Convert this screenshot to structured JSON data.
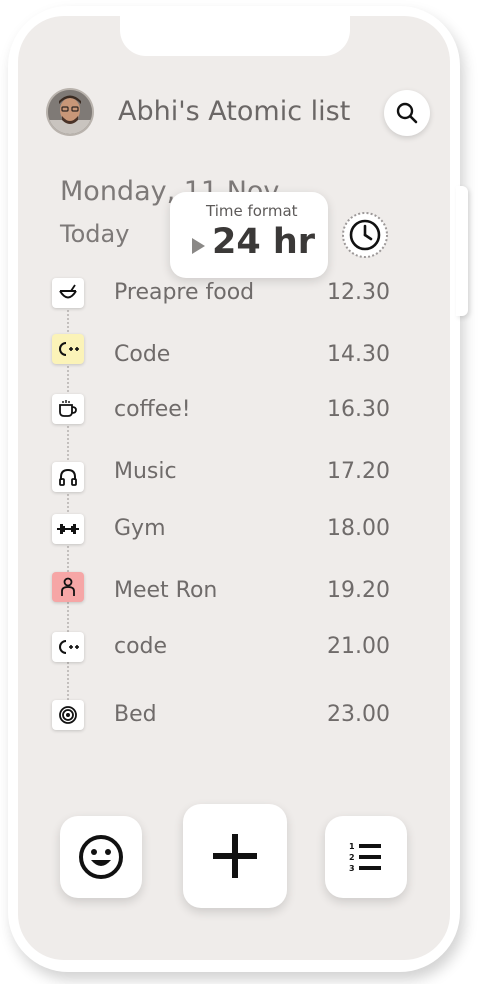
{
  "header": {
    "title": "Abhi's Atomic list",
    "avatar_icon": "user-avatar",
    "search_icon": "search-icon"
  },
  "date": {
    "label": "Monday, 11 Nov",
    "today": "Today"
  },
  "time_format_popup": {
    "label": "Time format",
    "value": "24 hr"
  },
  "tasks": [
    {
      "name": "Preapre food",
      "time": "12.30",
      "icon": "bowl-icon",
      "icon_bg": "#ffffff"
    },
    {
      "name": "Code",
      "time": "14.30",
      "icon": "cpp-icon",
      "icon_bg": "#fbf3b8"
    },
    {
      "name": "coffee!",
      "time": "16.30",
      "icon": "coffee-cup-icon",
      "icon_bg": "#ffffff"
    },
    {
      "name": "Music",
      "time": "17.20",
      "icon": "headphones-icon",
      "icon_bg": "#ffffff"
    },
    {
      "name": "Gym",
      "time": "18.00",
      "icon": "dumbbell-icon",
      "icon_bg": "#ffffff"
    },
    {
      "name": "Meet Ron",
      "time": "19.20",
      "icon": "person-icon",
      "icon_bg": "#f6a6a6"
    },
    {
      "name": "code",
      "time": "21.00",
      "icon": "cpp-icon",
      "icon_bg": "#ffffff"
    },
    {
      "name": "Bed",
      "time": "23.00",
      "icon": "target-icon",
      "icon_bg": "#ffffff"
    }
  ],
  "bottom_bar": {
    "mood_icon": "smiley-icon",
    "add_icon": "plus-icon",
    "list_icon": "numbered-list-icon"
  }
}
